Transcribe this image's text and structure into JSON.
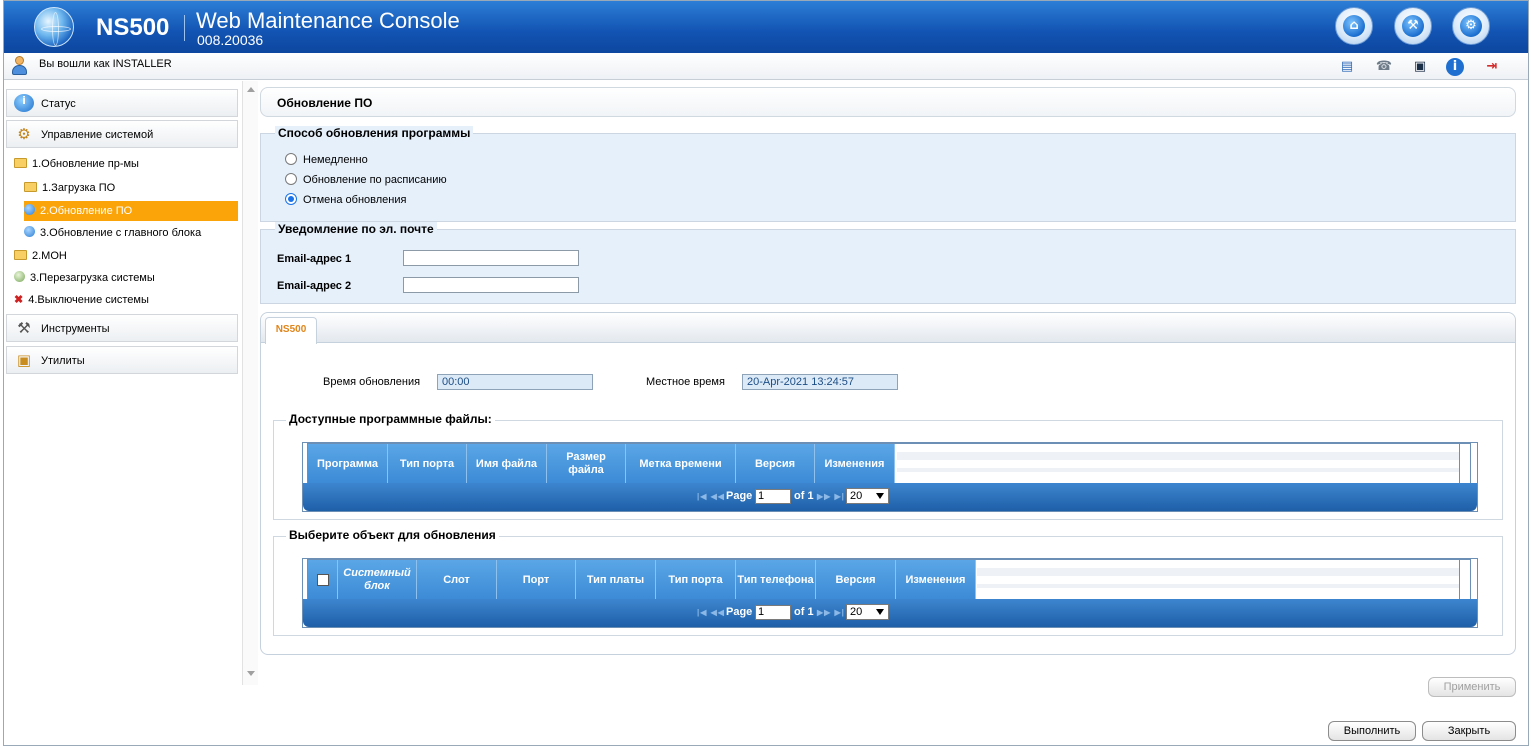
{
  "header": {
    "model": "NS500",
    "title": "Web Maintenance Console",
    "version": "008.20036",
    "buttons": [
      "home-icon",
      "tools-icon",
      "gear-icon"
    ]
  },
  "userbar": {
    "text": "Вы вошли как INSTALLER"
  },
  "sidebar": {
    "status": "Статус",
    "sysmgmt": "Управление системой",
    "upd": "1.Обновление пр-мы",
    "dl": "1.Загрузка ПО",
    "updsw": "2.Обновление ПО",
    "frommain": "3.Обновление с главного блока",
    "moh": "2.MOH",
    "restart": "3.Перезагрузка системы",
    "shutdown": "4.Выключение системы",
    "tools": "Инструменты",
    "utils": "Утилиты"
  },
  "page": {
    "title": "Обновление ПО"
  },
  "method": {
    "legend": "Способ обновления программы",
    "options": [
      "Немедленно",
      "Обновление по расписанию",
      "Отмена обновления"
    ],
    "selected": "Отмена обновления"
  },
  "email": {
    "legend": "Уведомление по эл. почте",
    "label1": "Email-адрес 1",
    "label2": "Email-адрес 2",
    "value1": "",
    "value2": ""
  },
  "tab": {
    "label": "NS500"
  },
  "times": {
    "upd_label": "Время обновления",
    "upd_value": "00:00",
    "local_label": "Местное время",
    "local_value": "20-Apr-2021 13:24:57"
  },
  "files": {
    "legend": "Доступные программные файлы:",
    "columns": [
      "Программа",
      "Тип порта",
      "Имя файла",
      "Размер файла",
      "Метка времени",
      "Версия",
      "Изменения"
    ],
    "rows": []
  },
  "targets": {
    "legend": "Выберите объект для обновления",
    "columns": [
      "Системный блок",
      "Слот",
      "Порт",
      "Тип платы",
      "Тип порта",
      "Тип телефона",
      "Версия",
      "Изменения"
    ],
    "rows": []
  },
  "pager": {
    "page_label": "Page",
    "page": "1",
    "of": "of 1",
    "size": "20"
  },
  "buttons": {
    "apply": "Применить",
    "execute": "Выполнить",
    "close": "Закрыть"
  }
}
